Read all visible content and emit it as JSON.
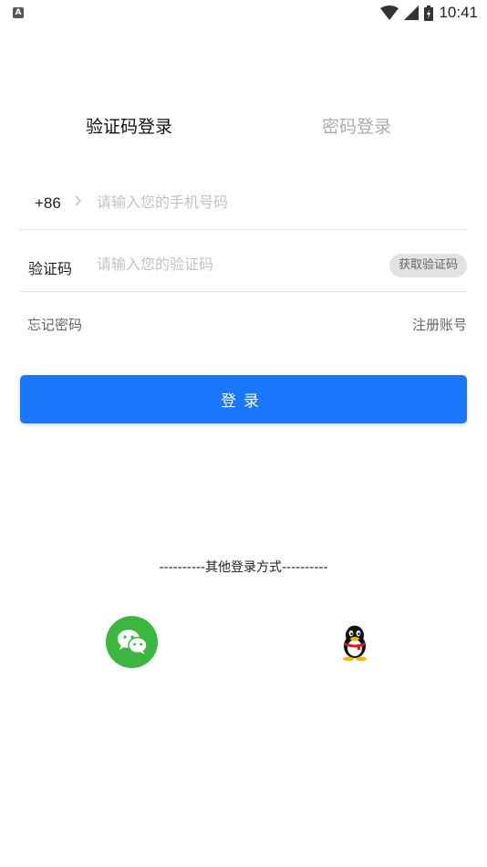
{
  "status_bar": {
    "notification_icon": "A",
    "time": "10:41"
  },
  "tabs": [
    {
      "label": "验证码登录",
      "active": true
    },
    {
      "label": "密码登录",
      "active": false
    }
  ],
  "phone": {
    "prefix": "+86",
    "placeholder": "请输入您的手机号码"
  },
  "code": {
    "label": "验证码",
    "placeholder": "请输入您的验证码",
    "button": "获取验证码"
  },
  "links": {
    "forgot": "忘记密码",
    "register": "注册账号"
  },
  "login_button": "登录",
  "other_login": {
    "title": "----------其他登录方式----------",
    "icons": [
      "wechat-icon",
      "qq-icon"
    ]
  },
  "colors": {
    "primary": "#1a77fb",
    "wechat": "#3bb73f",
    "muted": "#a9acb3"
  }
}
